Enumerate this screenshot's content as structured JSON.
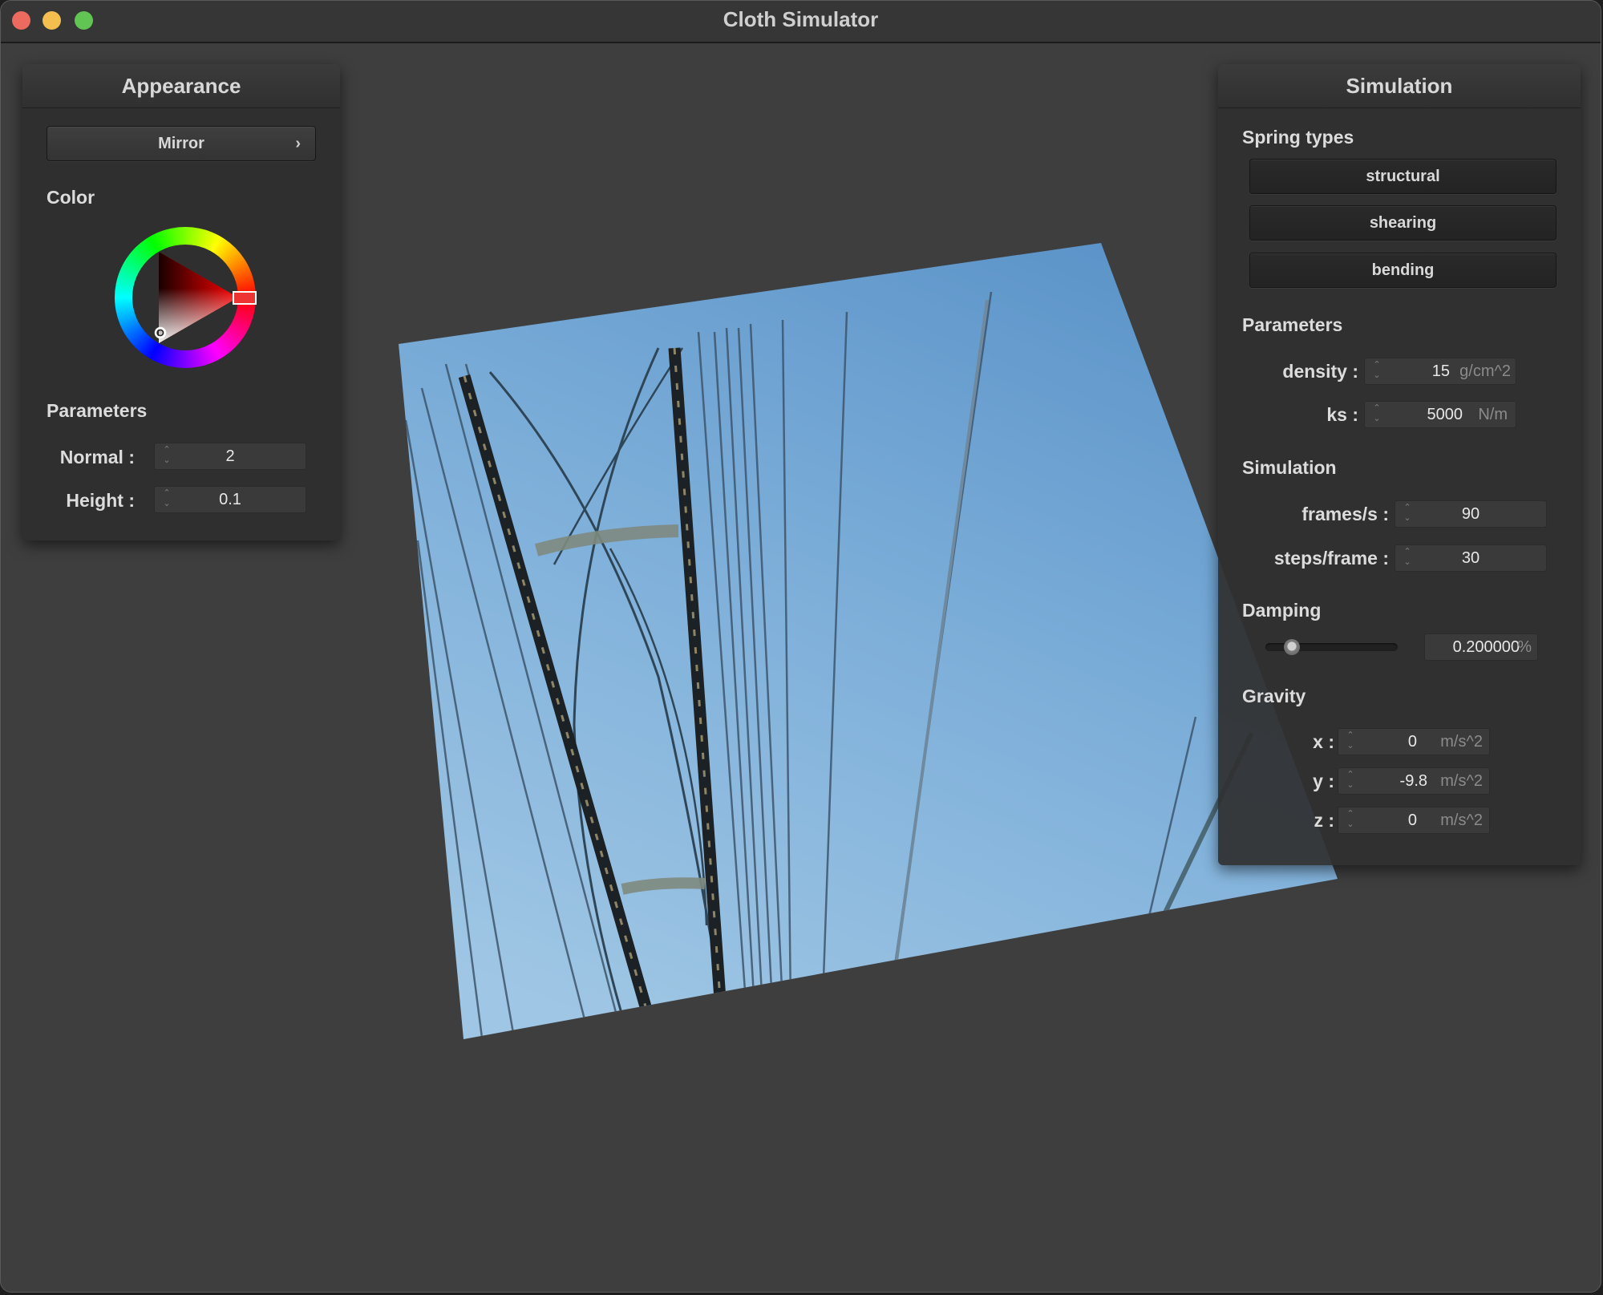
{
  "window": {
    "title": "Cloth Simulator"
  },
  "appearance": {
    "title": "Appearance",
    "shader_select": {
      "label": "Mirror"
    },
    "color_label": "Color",
    "color_picker": {
      "selected_hue_color": "#ff0000"
    },
    "parameters_label": "Parameters",
    "normal": {
      "label": "Normal :",
      "value": "2"
    },
    "height": {
      "label": "Height :",
      "value": "0.1"
    }
  },
  "simulation": {
    "title": "Simulation",
    "spring_types_label": "Spring types",
    "spring_buttons": [
      "structural",
      "shearing",
      "bending"
    ],
    "parameters_label": "Parameters",
    "density": {
      "label": "density :",
      "value": "15",
      "unit": "g/cm^2"
    },
    "ks": {
      "label": "ks :",
      "value": "5000",
      "unit": "N/m"
    },
    "simulation_label": "Simulation",
    "fps": {
      "label": "frames/s :",
      "value": "90"
    },
    "steps": {
      "label": "steps/frame :",
      "value": "30"
    },
    "damping_label": "Damping",
    "damping": {
      "value": "0.200000",
      "unit": "%",
      "slider_fraction": 0.2
    },
    "gravity_label": "Gravity",
    "gravity": [
      {
        "label": "x :",
        "value": "0",
        "unit": "m/s^2"
      },
      {
        "label": "y :",
        "value": "-9.8",
        "unit": "m/s^2"
      },
      {
        "label": "z :",
        "value": "0",
        "unit": "m/s^2"
      }
    ]
  },
  "colors": {
    "sky_light": "#8ab9de",
    "sky_dark": "#5f96c8"
  }
}
